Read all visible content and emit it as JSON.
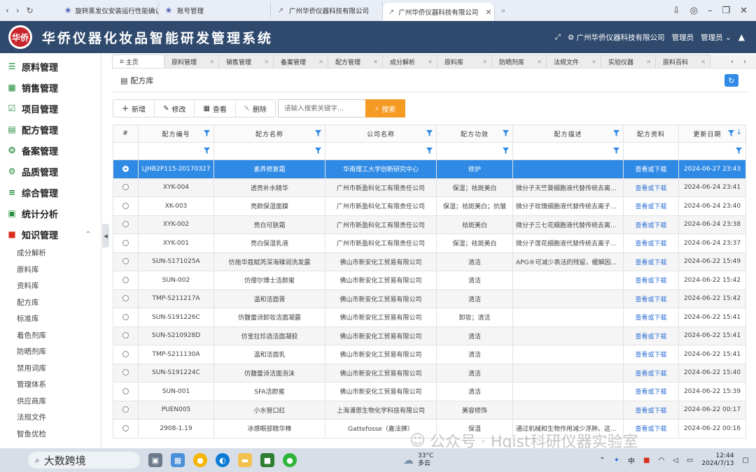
{
  "browser": {
    "tabs": [
      {
        "title": "旋转蒸发仪安装运行性能确认 - 百",
        "active": false
      },
      {
        "title": "账号管理",
        "active": false
      },
      {
        "title": "广州华侨仪器科技有限公司",
        "active": false
      },
      {
        "title": "广州华侨仪器科技有限公司",
        "active": true
      }
    ]
  },
  "header": {
    "logo_text": "华侨",
    "title": "华侨仪器化妆品智能研发管理系统",
    "company": "广州华侨仪器科技有限公司",
    "role": "管理员",
    "user": "管理员"
  },
  "sidebar": {
    "menu": [
      {
        "label": "原料管理",
        "icon": "database-icon"
      },
      {
        "label": "销售管理",
        "icon": "book-icon"
      },
      {
        "label": "项目管理",
        "icon": "checklist-icon"
      },
      {
        "label": "配方管理",
        "icon": "document-icon"
      },
      {
        "label": "备案管理",
        "icon": "settings-circle-icon"
      },
      {
        "label": "品质管理",
        "icon": "gear-icon"
      },
      {
        "label": "综合管理",
        "icon": "list-icon"
      },
      {
        "label": "统计分析",
        "icon": "truck-icon"
      },
      {
        "label": "知识管理",
        "icon": "briefcase-icon"
      }
    ],
    "sub_items": [
      "成分解析",
      "原料库",
      "资料库",
      "配方库",
      "标准库",
      "着色剂库",
      "防晒剂库",
      "禁用词库",
      "管理体系",
      "供应商库",
      "法规文件",
      "智鱼优检"
    ]
  },
  "content_tabs": [
    "主页",
    "原料管理",
    "销售管理",
    "备案管理",
    "配方管理",
    "成分解析",
    "原料库",
    "防晒剂库",
    "法规文件",
    "实验仪器",
    "原料百科"
  ],
  "panel": {
    "title": "配方库"
  },
  "toolbar": {
    "add": "新增",
    "edit": "修改",
    "view": "查看",
    "delete": "删除",
    "search_placeholder": "请输入搜索关键字...",
    "search": "搜索"
  },
  "table": {
    "columns": [
      "#",
      "配方编号",
      "配方名称",
      "公司名称",
      "配方功效",
      "配方描述",
      "配方资料",
      "更新日期"
    ],
    "rows": [
      [
        "LJHB2P115-20170327",
        "素养修复霜",
        "华南理工大学创新研究中心",
        "修护",
        "",
        "查看或下载",
        "2024-06-27 23:43"
      ],
      [
        "XYK-004",
        "透亮补水精华",
        "广州市新盈科化工有限责任公司",
        "保湿；祛斑美白",
        "微分子天竺葵细胞液代替传统去离...",
        "查看或下载",
        "2024-06-24 23:41"
      ],
      [
        "XK-003",
        "亮颜保湿面膜",
        "广州市新盈科化工有限责任公司",
        "保湿；祛斑美白；抗皱",
        "微分子玫瑰细胞液代替传统去离子...",
        "查看或下载",
        "2024-06-24 23:40"
      ],
      [
        "XYK-002",
        "亮白可肤霜",
        "广州市新盈科化工有限责任公司",
        "祛斑美白",
        "微分子三七花细胞液代替传统去离...",
        "查看或下载",
        "2024-06-24 23:38"
      ],
      [
        "XYK-001",
        "亮白保湿乳液",
        "广州市新盈科化工有限责任公司",
        "保湿；祛斑美白",
        "微分子莲花细胞液代替传统去离子...",
        "查看或下载",
        "2024-06-24 23:37"
      ],
      [
        "SUN-S171025A",
        "仿施华蔻赋芮深海臻润洗发露",
        "佛山市新安化工贸易有限公司",
        "清洁",
        "APG®可减少表活的残留，缓解因...",
        "查看或下载",
        "2024-06-22 15:49"
      ],
      [
        "SUN-002",
        "仿缨尔博士洁颜蜜",
        "佛山市新安化工贸易有限公司",
        "清洁",
        "",
        "查看或下载",
        "2024-06-22 15:42"
      ],
      [
        "TMP-S211217A",
        "温和洁面膏",
        "佛山市新安化工贸易有限公司",
        "清洁",
        "",
        "查看或下载",
        "2024-06-22 15:42"
      ],
      [
        "SUN-S191226C",
        "仿馥蕾诗卸妆洁面凝露",
        "佛山市新安化工贸易有限公司",
        "卸妆；清洁",
        "",
        "查看或下载",
        "2024-06-22 15:41"
      ],
      [
        "SUN-S210928D",
        "仿宝拉珍选洁面凝胶",
        "佛山市新安化工贸易有限公司",
        "清洁",
        "",
        "查看或下载",
        "2024-06-22 15:41"
      ],
      [
        "TMP-S211130A",
        "温和洁面乳",
        "佛山市新安化工贸易有限公司",
        "清洁",
        "",
        "查看或下载",
        "2024-06-22 15:41"
      ],
      [
        "SUN-S191224C",
        "仿馥蕾诗洁面泡沫",
        "佛山市新安化工贸易有限公司",
        "清洁",
        "",
        "查看或下载",
        "2024-06-22 15:40"
      ],
      [
        "SUN-001",
        "SFA洁颜蜜",
        "佛山市新安化工贸易有限公司",
        "清洁",
        "",
        "查看或下载",
        "2024-06-22 15:39"
      ],
      [
        "PUEN005",
        "小水管口红",
        "上海浦恩生物化学科技有限公司",
        "美容修饰",
        "",
        "查看或下载",
        "2024-06-22 00:17"
      ],
      [
        "2908-1.19",
        "冰感眼部精华棒",
        "Gattefosse（嘉法狮）",
        "保湿",
        "通过机械和生物作用减少浮肿。这...",
        "查看或下载",
        "2024-06-22 00:16"
      ]
    ]
  },
  "watermark": "公众号 · Hqist科研仪器实验室",
  "taskbar": {
    "search": "大数跨境",
    "temp": "33°C",
    "weather": "多云",
    "ime": "中",
    "time": "12:44",
    "date": "2024/7/13"
  },
  "colors": {
    "header_bg": "#2f4a6d",
    "accent": "#2f8ae5",
    "search_btn": "#f59a23",
    "sidebar_icon": "#1e8c3a"
  }
}
